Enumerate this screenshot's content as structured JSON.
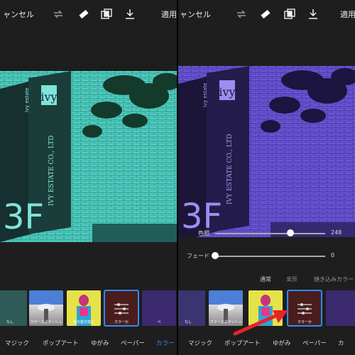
{
  "left": {
    "toolbar": {
      "cancel": "ャンセル",
      "apply": "適用"
    },
    "filters": [
      {
        "caption": "なし"
      },
      {
        "caption": "カラースプラッシュ"
      },
      {
        "caption": "色の置き換え"
      },
      {
        "caption": "カラーか"
      },
      {
        "caption": "ペ"
      }
    ],
    "tabs": [
      "マジック",
      "ポップアート",
      "ゆがみ",
      "ペーパー",
      "カラー"
    ],
    "active_tab": "カラー"
  },
  "right": {
    "toolbar": {
      "cancel": "ャンセル",
      "apply": "適用"
    },
    "sliders": [
      {
        "label": "色相",
        "value": "248",
        "fraction": 0.71
      },
      {
        "label": "フェード",
        "value": "0",
        "fraction": 0.0
      }
    ],
    "blend_modes": [
      "通常",
      "乗算",
      "焼き込みカラー"
    ],
    "active_blend": "通常",
    "filters": [
      {
        "caption": "なし"
      },
      {
        "caption": "カラースプラッシュ"
      },
      {
        "caption": ""
      },
      {
        "caption": "カラーか"
      },
      {
        "caption": ""
      }
    ],
    "tabs": [
      "マジック",
      "ポップアート",
      "ゆがみ",
      "ペーパー",
      "カ"
    ]
  },
  "photo": {
    "sign_vertical": "IVY ESTATE CO., LTD",
    "sign_logo": "ivy estate",
    "floor": "3F"
  },
  "colors": {
    "left_tint": "#4fd0c3",
    "right_tint": "#6a55d8",
    "accent": "#3d8bff",
    "arrow": "#e8232b"
  }
}
